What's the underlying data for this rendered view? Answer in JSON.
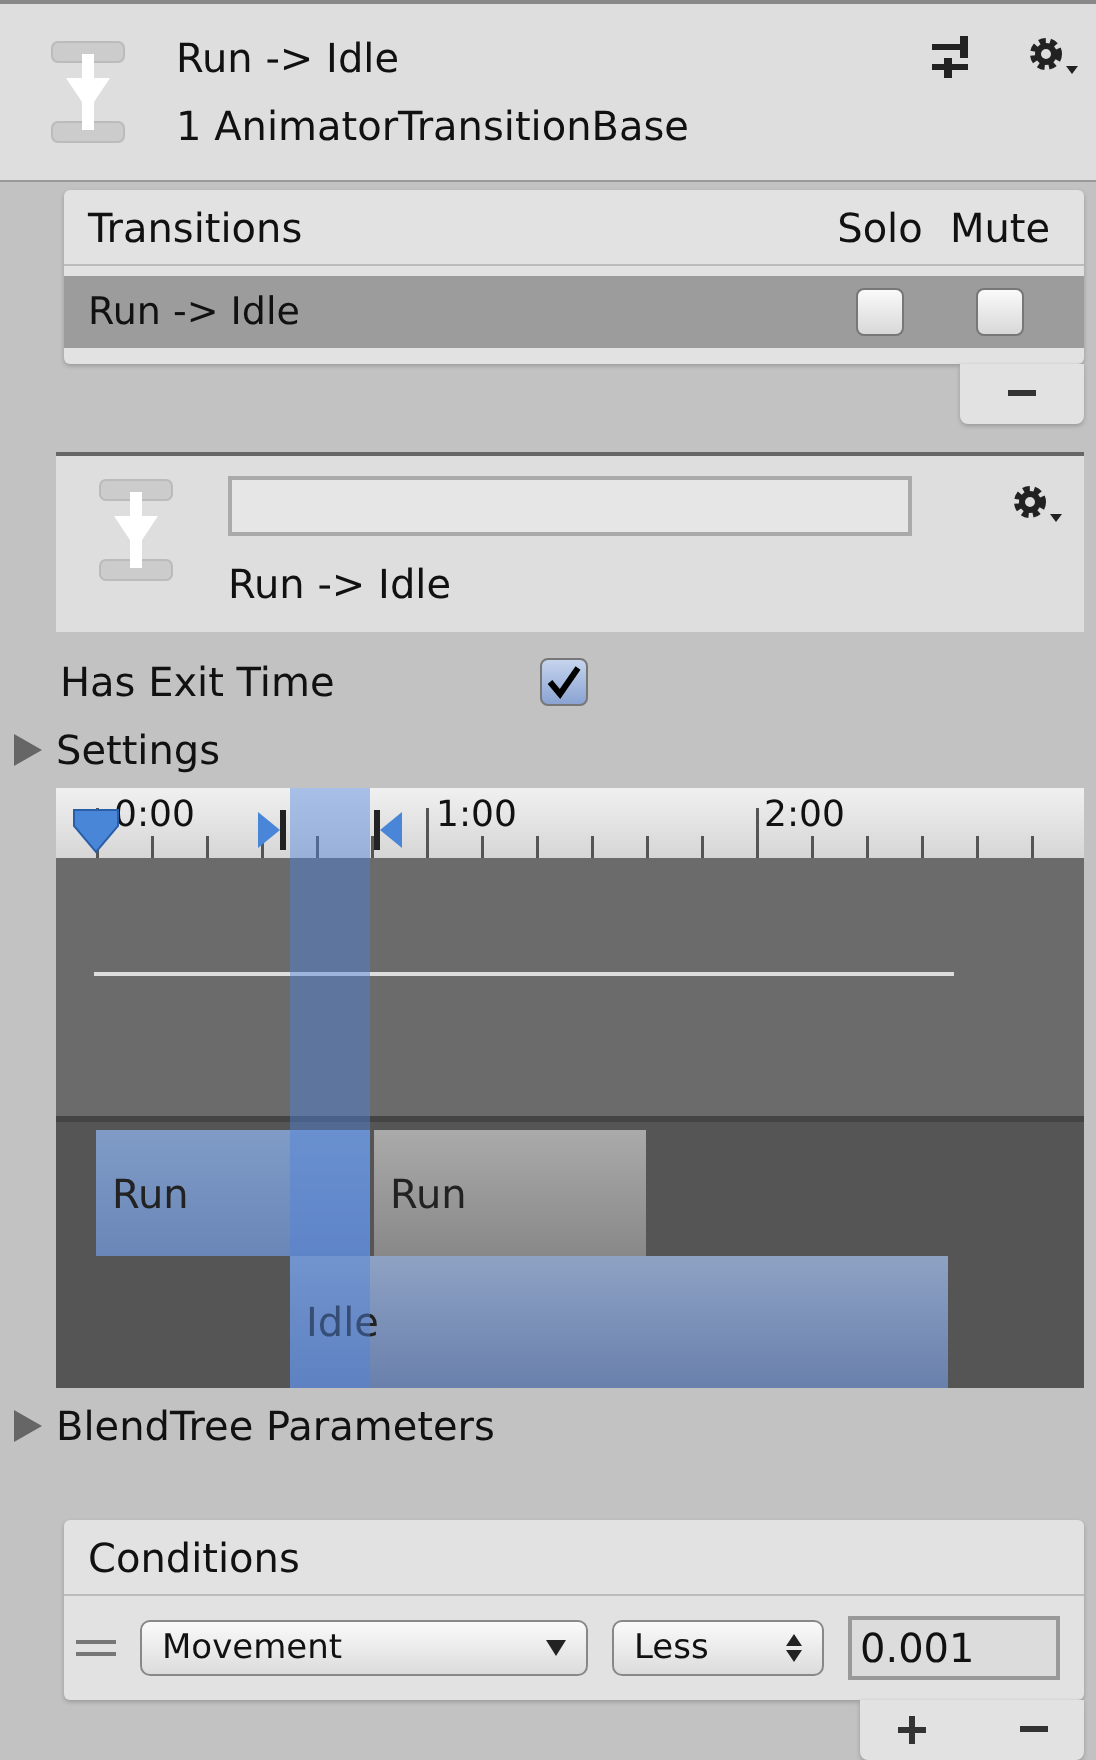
{
  "header": {
    "title": "Run -> Idle",
    "subtitle": "1 AnimatorTransitionBase"
  },
  "transitions": {
    "title": "Transitions",
    "columns": [
      "Solo",
      "Mute"
    ],
    "rows": [
      {
        "name": "Run -> Idle",
        "selected": true,
        "solo": false,
        "mute": false
      }
    ]
  },
  "transition": {
    "label": "Run -> Idle"
  },
  "has_exit_time": {
    "label": "Has Exit Time",
    "checked": true
  },
  "settings": {
    "label": "Settings",
    "expanded": false
  },
  "timeline": {
    "ticks": [
      "0:00",
      "1:00",
      "2:00"
    ],
    "clips": [
      {
        "label": "Run",
        "kind": "source"
      },
      {
        "label": "Run",
        "kind": "source_after"
      },
      {
        "label": "Idle",
        "kind": "destination"
      }
    ]
  },
  "blend_tree": {
    "label": "BlendTree Parameters",
    "expanded": false
  },
  "conditions": {
    "title": "Conditions",
    "rows": [
      {
        "parameter": "Movement",
        "mode": "Less",
        "value": "0.001"
      }
    ]
  }
}
